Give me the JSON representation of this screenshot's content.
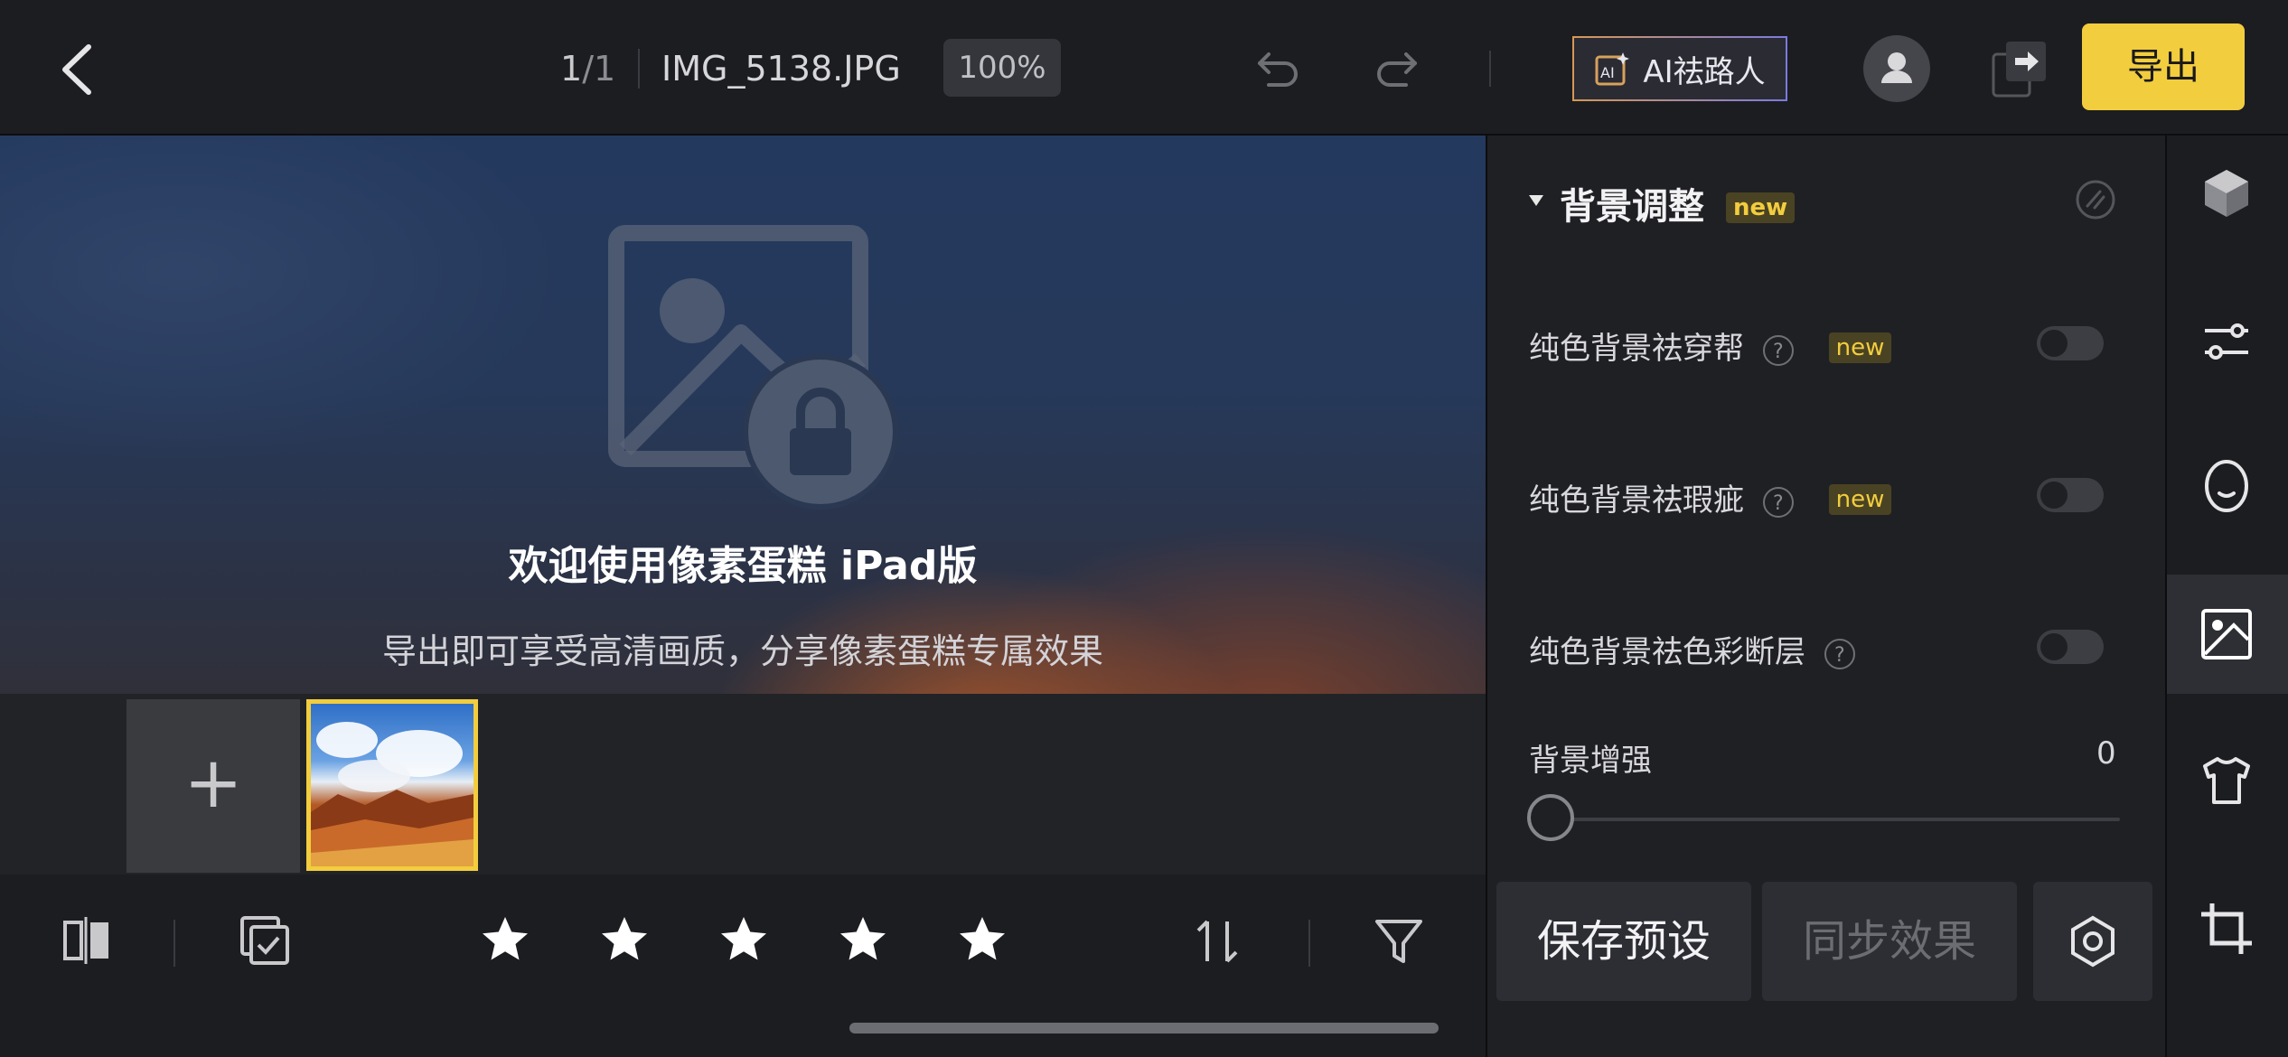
{
  "header": {
    "index_current": "1",
    "index_total": "/1",
    "filename": "IMG_5138.JPG",
    "zoom": "100%",
    "ai_button": "AI祛路人",
    "export_button": "导出"
  },
  "canvas": {
    "welcome_title": "欢迎使用像素蛋糕 iPad版",
    "welcome_subtitle": "导出即可享受高清画质，分享像素蛋糕专属效果"
  },
  "filmstrip": {
    "add_symbol": "+",
    "selected_thumbnail": "IMG_5138.JPG"
  },
  "rating": {
    "stars": 5
  },
  "panel": {
    "section_title": "背景调整",
    "section_badge": "new",
    "rows": [
      {
        "label": "纯色背景祛穿帮",
        "badge": "new",
        "on": false
      },
      {
        "label": "纯色背景祛瑕疵",
        "badge": "new",
        "on": false
      },
      {
        "label": "纯色背景祛色彩断层",
        "badge": "",
        "on": false
      }
    ],
    "slider": {
      "label": "背景增强",
      "value": "0"
    },
    "save_preset": "保存预设",
    "sync_effect": "同步效果"
  },
  "rail": {
    "items": [
      "cube-icon",
      "sliders-icon",
      "face-icon",
      "background-image-icon",
      "shirt-icon",
      "crop-icon"
    ],
    "active": "background-image-icon"
  },
  "colors": {
    "accent": "#f2cd3e",
    "panel_bg": "#1f2024",
    "badge_bg": "#4a4323"
  }
}
